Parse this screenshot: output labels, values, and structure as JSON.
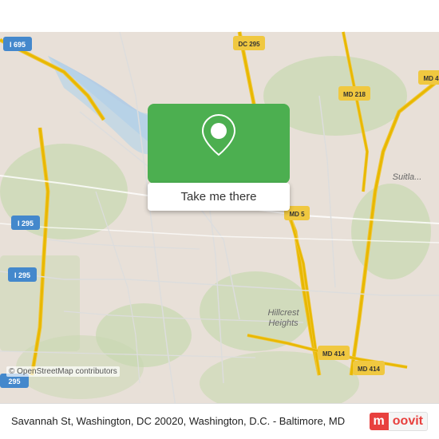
{
  "map": {
    "attribution": "© OpenStreetMap contributors",
    "background_color": "#e8e0d8"
  },
  "pin_popup": {
    "button_label": "Take me there"
  },
  "bottom_bar": {
    "address": "Savannah St, Washington, DC 20020, Washington, D.C. - Baltimore, MD",
    "logo_m": "m",
    "logo_rest": "oovit"
  }
}
